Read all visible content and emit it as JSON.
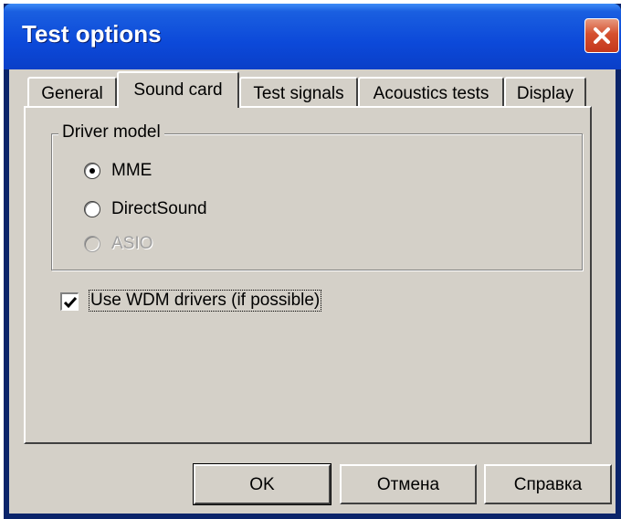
{
  "window": {
    "title": "Test options"
  },
  "tabs": [
    {
      "label": "General",
      "active": false
    },
    {
      "label": "Sound card",
      "active": true
    },
    {
      "label": "Test signals",
      "active": false
    },
    {
      "label": "Acoustics tests",
      "active": false
    },
    {
      "label": "Display",
      "active": false
    }
  ],
  "driver_model": {
    "legend": "Driver model",
    "options": [
      {
        "label": "MME",
        "selected": true,
        "enabled": true
      },
      {
        "label": "DirectSound",
        "selected": false,
        "enabled": true
      },
      {
        "label": "ASIO",
        "selected": false,
        "enabled": false
      }
    ]
  },
  "wdm": {
    "label": "Use WDM drivers (if possible)",
    "checked": true
  },
  "buttons": {
    "ok": "OK",
    "cancel": "Отмена",
    "help": "Справка"
  },
  "colors": {
    "title_bar": "#0c49d9",
    "close_button": "#d5502f",
    "face": "#d4d0c8"
  },
  "icons": {
    "close": "close-icon",
    "check": "checkmark-icon"
  }
}
